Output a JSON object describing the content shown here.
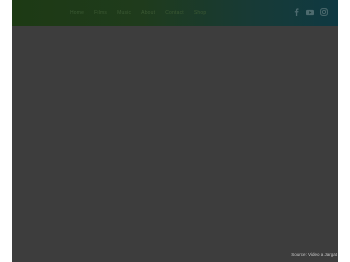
{
  "nav": {
    "items": [
      {
        "label": "Home"
      },
      {
        "label": "Films"
      },
      {
        "label": "Music"
      },
      {
        "label": "About"
      },
      {
        "label": "Contact"
      },
      {
        "label": "Shop"
      }
    ]
  },
  "social": [
    {
      "icon": "facebook-icon"
    },
    {
      "icon": "youtube-icon"
    },
    {
      "icon": "instagram-icon"
    }
  ],
  "footer": {
    "credit": "Source: Video a Jargat"
  },
  "colors": {
    "header_start": "#1d3a14",
    "header_end": "#0f3942",
    "content_bg": "#3d3d3d"
  }
}
